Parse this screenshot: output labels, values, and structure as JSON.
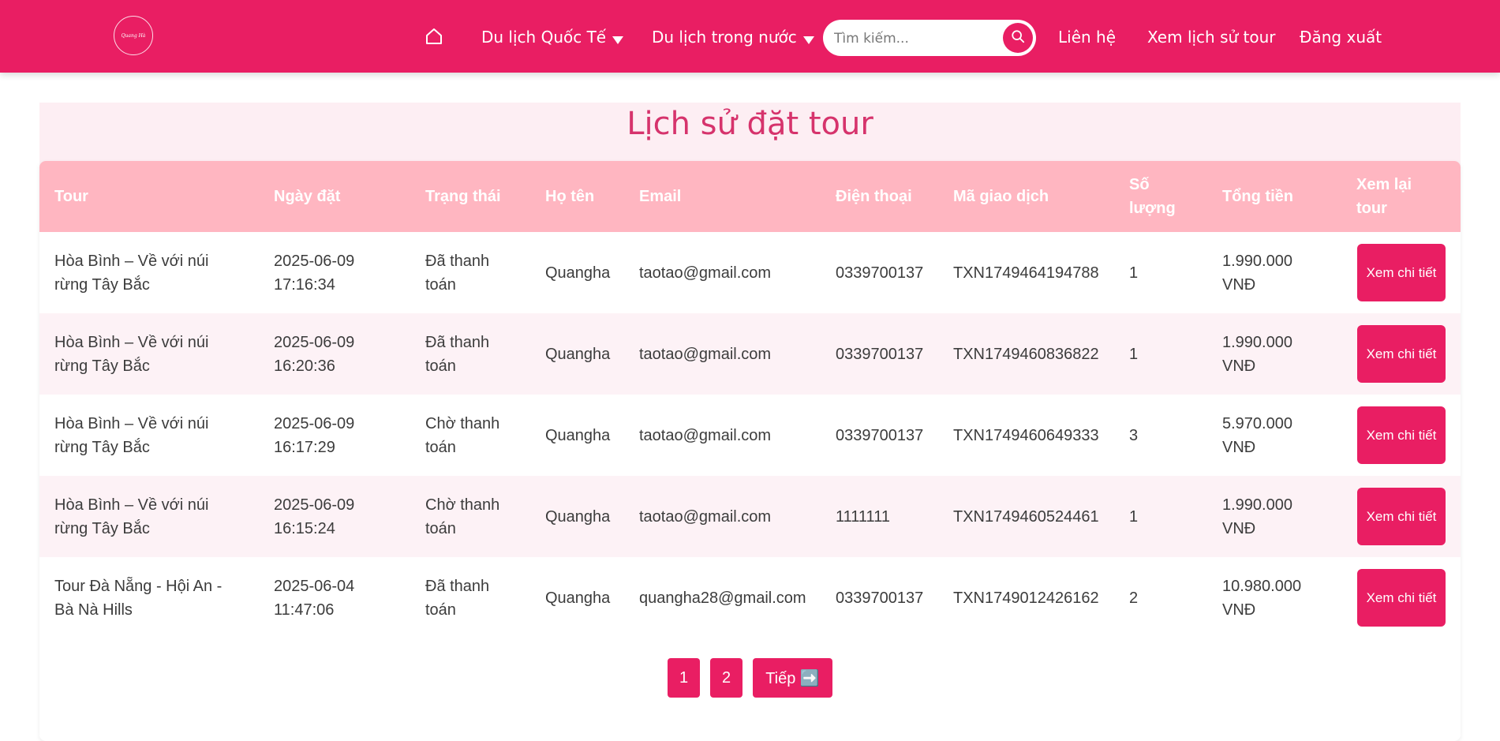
{
  "nav": {
    "logo_text": "Quang Hà",
    "intl_label": "Du lịch Quốc Tế",
    "domestic_label": "Du lịch trong nước",
    "search_placeholder": "Tìm kiếm...",
    "contact_label": "Liên hệ",
    "history_label": "Xem lịch sử tour",
    "logout_label": "Đăng xuất"
  },
  "page": {
    "title": "Lịch sử đặt tour"
  },
  "table": {
    "headers": [
      "Tour",
      "Ngày đặt",
      "Trạng thái",
      "Họ tên",
      "Email",
      "Điện thoại",
      "Mã giao dịch",
      "Số lượng",
      "Tổng tiền",
      "Xem lại tour"
    ],
    "rows": [
      {
        "tour": "Hòa Bình – Về với núi rừng Tây Bắc",
        "date": "2025-06-09 17:16:34",
        "status": "Đã thanh toán",
        "name": "Quangha",
        "email": "taotao@gmail.com",
        "phone": "0339700137",
        "txn": "TXN1749464194788",
        "qty": "1",
        "total": "1.990.000 VNĐ",
        "action": "Xem chi tiết"
      },
      {
        "tour": "Hòa Bình – Về với núi rừng Tây Bắc",
        "date": "2025-06-09 16:20:36",
        "status": "Đã thanh toán",
        "name": "Quangha",
        "email": "taotao@gmail.com",
        "phone": "0339700137",
        "txn": "TXN1749460836822",
        "qty": "1",
        "total": "1.990.000 VNĐ",
        "action": "Xem chi tiết"
      },
      {
        "tour": "Hòa Bình – Về với núi rừng Tây Bắc",
        "date": "2025-06-09 16:17:29",
        "status": "Chờ thanh toán",
        "name": "Quangha",
        "email": "taotao@gmail.com",
        "phone": "0339700137",
        "txn": "TXN1749460649333",
        "qty": "3",
        "total": "5.970.000 VNĐ",
        "action": "Xem chi tiết"
      },
      {
        "tour": "Hòa Bình – Về với núi rừng Tây Bắc",
        "date": "2025-06-09 16:15:24",
        "status": "Chờ thanh toán",
        "name": "Quangha",
        "email": "taotao@gmail.com",
        "phone": "1111111",
        "txn": "TXN1749460524461",
        "qty": "1",
        "total": "1.990.000 VNĐ",
        "action": "Xem chi tiết"
      },
      {
        "tour": "Tour Đà Nẵng - Hội An - Bà Nà Hills",
        "date": "2025-06-04 11:47:06",
        "status": "Đã thanh toán",
        "name": "Quangha",
        "email": "quangha28@gmail.com",
        "phone": "0339700137",
        "txn": "TXN1749012426162",
        "qty": "2",
        "total": "10.980.000 VNĐ",
        "action": "Xem chi tiết"
      }
    ]
  },
  "pagination": {
    "page1": "1",
    "page2": "2",
    "next_label": "Tiếp ➡️"
  },
  "colors": {
    "brand": "#e91e63",
    "header_row": "#ffb6c1",
    "panel": "#fdeef3",
    "title": "#d6336c"
  }
}
